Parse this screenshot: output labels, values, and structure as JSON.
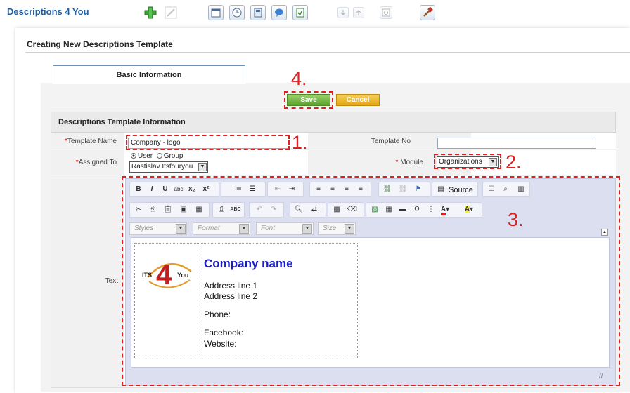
{
  "app": {
    "title": "Descriptions 4 You"
  },
  "toolbar": {
    "icons": [
      "add-icon",
      "edit-icon",
      "calendar-icon",
      "clock-icon",
      "calculator-icon",
      "chat-icon",
      "import-icon",
      "export-arrow-down-icon",
      "export-arrow-up-icon",
      "find-duplicates-icon",
      "settings-hammer-icon"
    ]
  },
  "page": {
    "title": "Creating New Descriptions Template",
    "tab_basic": "Basic Information",
    "save_label": "Save",
    "cancel_label": "Cancel",
    "section_title": "Descriptions Template Information"
  },
  "form": {
    "template_name_label": "Template Name",
    "template_name_value": "Company - logo",
    "template_no_label": "Template No",
    "template_no_value": "",
    "assigned_to_label": "Assigned To",
    "radio_user": "User",
    "radio_group": "Group",
    "assigned_user": "Rastislav Itsfouryou",
    "module_label": "Module",
    "module_value": "Organizations",
    "text_label": "Text",
    "required_mark": "*"
  },
  "editor": {
    "source_label": "Source",
    "styles_placeholder": "Styles",
    "format_placeholder": "Format",
    "font_placeholder": "Font",
    "size_placeholder": "Size",
    "content": {
      "logo_its": "ITS",
      "logo_4": "4",
      "logo_you": "You",
      "company": "Company name",
      "address1": "Address line 1",
      "address2": "Address line 2",
      "phone": "Phone:",
      "facebook": "Facebook:",
      "website": "Website:"
    }
  },
  "annotations": {
    "n1": "1.",
    "n2": "2.",
    "n3": "3.",
    "n4": "4."
  },
  "colors": {
    "annotation": "#e02020",
    "brand_title": "#1d5fa8",
    "save": "#5aa02c",
    "cancel": "#e5a514",
    "company_name": "#1b1bd0"
  }
}
